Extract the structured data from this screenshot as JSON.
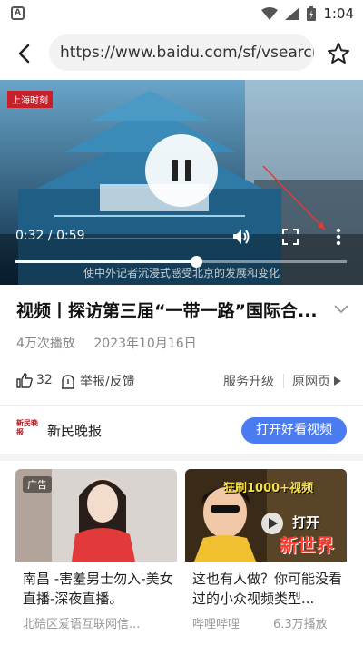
{
  "status_bar": {
    "time": "1:04",
    "app_icon_letter": "A"
  },
  "browser": {
    "url": "https://www.baidu.com/sf/vsearch",
    "icons": [
      "back-arrow-icon",
      "star-icon"
    ]
  },
  "video": {
    "logo": "上海时刻",
    "time_current": "0:32",
    "time_total": "0:59",
    "time_separator": "/",
    "progress": 0.545,
    "subtitle": "使中外记者沉浸式感受北京的发展和变化",
    "controls": [
      "pause-icon",
      "volume-icon",
      "fullscreen-icon",
      "more-vertical-icon"
    ]
  },
  "article": {
    "title": "视频丨探访第三届“一带一路”国际合...",
    "views": "4万次播放",
    "date": "2023年10月16日"
  },
  "actions": {
    "like_count": "32",
    "report": "举报/反馈",
    "service_upgrade": "服务升级",
    "original_page": "原网页"
  },
  "author": {
    "logo_text": "新民晚报",
    "name": "新民晚报",
    "open_button": "打开好看视频"
  },
  "cards": [
    {
      "ad_tag": "广告",
      "title": "南昌 -害羞男士勿入-美女直播-深夜直播。",
      "source": "北碚区爱语互联网信...",
      "count": ""
    },
    {
      "overlay_top": "狂刷1000+视频",
      "overlay_mid": "打开",
      "overlay_big": "新世界",
      "title": "这也有人做？你可能没看过的小众视频类型...",
      "source": "哔哩哔哩",
      "count": "6.3万播放"
    }
  ],
  "colors": {
    "accent": "#4a7bf0",
    "brand_red": "#c8202b"
  }
}
